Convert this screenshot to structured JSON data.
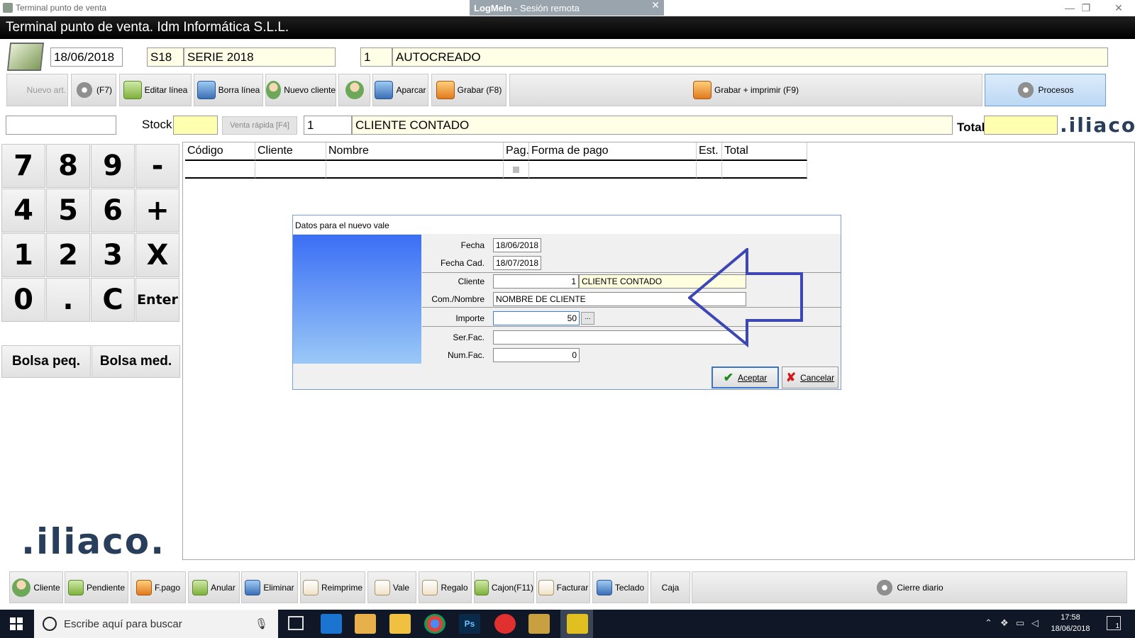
{
  "window": {
    "title": "Terminal punto de venta",
    "logmein_brand": "LogMeIn",
    "logmein_label": " -  Sesión remota",
    "logmein_close": "✕",
    "min": "—",
    "restore": "❐",
    "close": "✕"
  },
  "app_title": "Terminal punto de venta. Idm Informática S.L.L.",
  "header": {
    "date": "18/06/2018",
    "serie_code": "S18",
    "serie_name": "SERIE 2018",
    "doc_number": "1",
    "doc_status": "AUTOCREADO"
  },
  "toolbar": {
    "nuevo_art": "Nuevo art.",
    "f7": "(F7)",
    "editar_linea": "Editar línea",
    "borra_linea": "Borra línea",
    "nuevo_cliente": "Nuevo cliente",
    "aparcar": "Aparcar",
    "grabar": "Grabar (F8)",
    "grabar_imprimir": "Grabar + imprimir (F9)",
    "procesos": "Procesos"
  },
  "row2": {
    "search_value": "",
    "stock_label": "Stock",
    "stock_value": "",
    "venta_rapida": "Venta rápida [F4]",
    "client_number": "1",
    "client_name": "CLIENTE CONTADO",
    "total_label": "Total",
    "total_value": "",
    "logo": ".iliaco."
  },
  "keypad": [
    "7",
    "8",
    "9",
    "-",
    "4",
    "5",
    "6",
    "+",
    "1",
    "2",
    "3",
    "X",
    "0",
    ".",
    "C",
    "Enter"
  ],
  "bag_buttons": [
    "Bolsa peq.",
    "Bolsa med."
  ],
  "logo_bottom": ".iliaco.",
  "grid": {
    "columns": [
      "Código",
      "Cliente",
      "Nombre",
      "Pag.",
      "Forma de pago",
      "Est.",
      "Total"
    ]
  },
  "dialog": {
    "title": "Datos para el nuevo vale",
    "fecha_label": "Fecha",
    "fecha_value": "18/06/2018",
    "fecha_cad_label": "Fecha Cad.",
    "fecha_cad_value": "18/07/2018",
    "cliente_label": "Cliente",
    "cliente_number": "1",
    "cliente_name": "CLIENTE CONTADO",
    "com_nombre_label": "Com./Nombre",
    "com_nombre_value": "NOMBRE DE CLIENTE",
    "importe_label": "Importe",
    "importe_value": "50",
    "importe_more": "...",
    "ser_fac_label": "Ser.Fac.",
    "ser_fac_value": "",
    "num_fac_label": "Num.Fac.",
    "num_fac_value": "0",
    "aceptar": "Aceptar",
    "cancelar": "Cancelar"
  },
  "bottom_toolbar": {
    "cliente": "Cliente",
    "pendiente": "Pendiente",
    "fpago": "F.pago",
    "anular": "Anular",
    "eliminar": "Eliminar",
    "reimprime": "Reimprime",
    "vale": "Vale",
    "regalo": "Regalo",
    "cajon": "Cajon(F11)",
    "facturar": "Facturar",
    "teclado": "Teclado",
    "caja": "Caja",
    "cierre_diario": "Cierre diario"
  },
  "taskbar": {
    "search_placeholder": "Escribe aquí para buscar",
    "time": "17:58",
    "date": "18/06/2018",
    "notification_count": "1"
  },
  "colors": {
    "field_yellow": "#ffffe8",
    "dialog_gradient_top": "#3a6ef5",
    "dialog_gradient_bottom": "#9ac8f7",
    "arrow": "#3c46b4",
    "taskbar": "#101828"
  }
}
